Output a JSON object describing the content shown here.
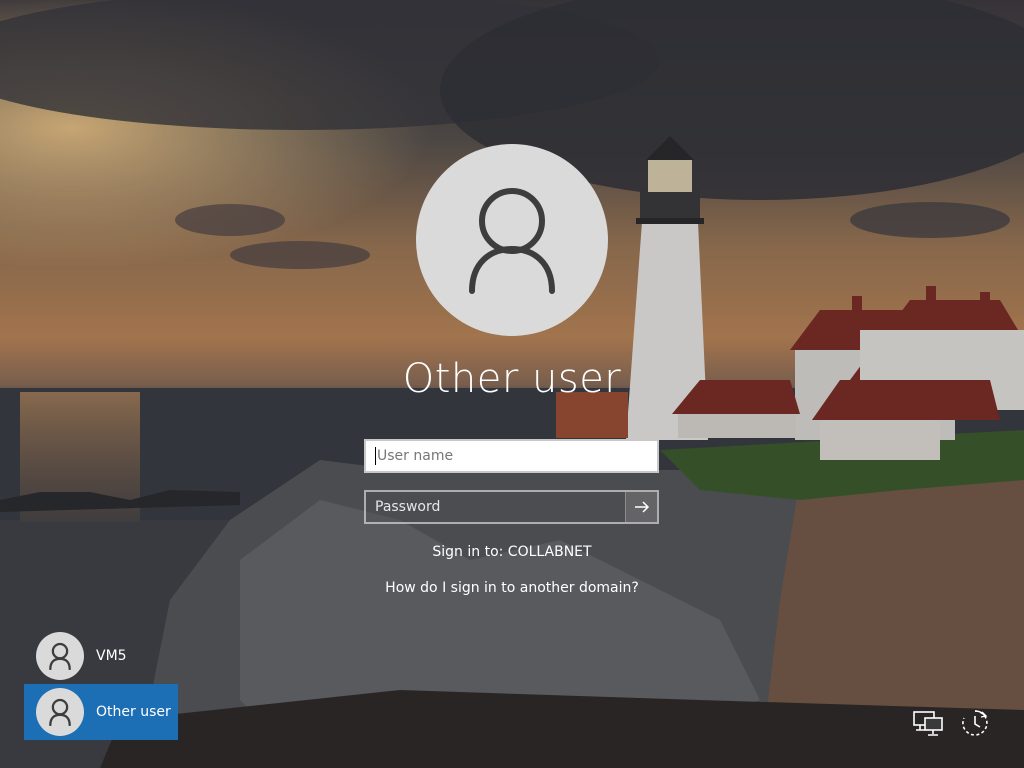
{
  "account": {
    "name": "Other user"
  },
  "form": {
    "username_placeholder": "User name",
    "password_placeholder": "Password",
    "sign_in_to": "Sign in to: COLLABNET",
    "domain_help_link": "How do I sign in to another domain?"
  },
  "user_list": [
    {
      "label": "VM5",
      "selected": false
    },
    {
      "label": "Other user",
      "selected": true
    }
  ],
  "icons": {
    "avatar": "user-silhouette-icon",
    "submit": "arrow-right-icon",
    "network": "network-icon",
    "accessibility": "ease-of-access-icon"
  },
  "colors": {
    "selected_tile": "#1d6fb5",
    "avatar_bg": "#dadada"
  }
}
